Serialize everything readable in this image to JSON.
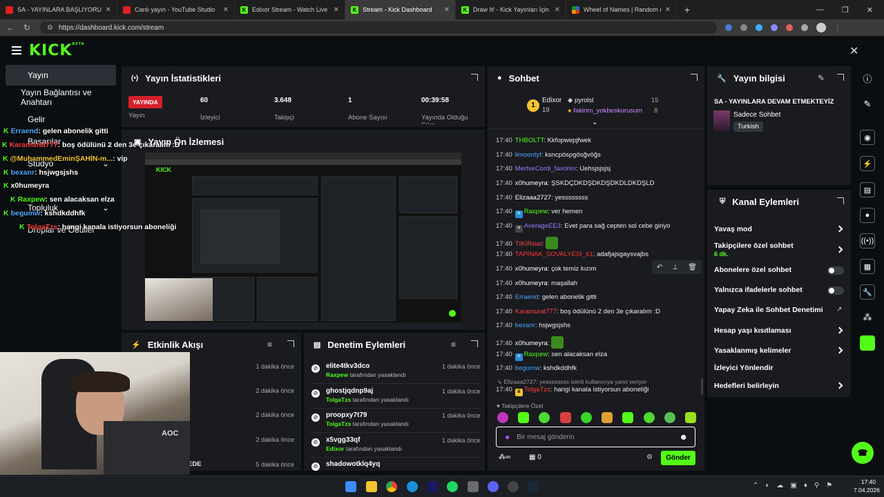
{
  "browser": {
    "tabs": [
      {
        "label": "SA - YAYINLARA BAŞLIYORUM - Yo",
        "icon": "yt"
      },
      {
        "label": "Canlı yayın - YouTube Studio",
        "icon": "yt"
      },
      {
        "label": "Edixor Stream - Watch Live on Kick",
        "icon": "kk"
      },
      {
        "label": "Stream - Kick Dashboard",
        "icon": "kk"
      },
      {
        "label": "Draw It! - Kick Yayınları İçin Çizim",
        "icon": "kk"
      },
      {
        "label": "Wheel of Names | Random name p",
        "icon": "wh"
      }
    ],
    "url": "https://dashboard.kick.com/stream"
  },
  "kick": {
    "logo": "KICK",
    "logo_sup": "BETA"
  },
  "sidebar": {
    "items": [
      "Yayın",
      "Yayın Bağlantısı ve Anahtarı",
      "Gelir",
      "Başarılar",
      "Stüdyo",
      "Topluluk",
      "Droplar ve Ödüller"
    ]
  },
  "stats": {
    "title": "Yayın İstatistikleri",
    "live": "YAYINDA",
    "live_label": "Yayın",
    "viewers": "60",
    "viewers_label": "İzleyici",
    "followers": "3.648",
    "followers_label": "Takipçi",
    "subs": "1",
    "subs_label": "Abone Sayısı",
    "uptime": "00:39:58",
    "uptime_label": "Yayında Olduğu Süre"
  },
  "preview": {
    "title": "Yayın Ön İzlemesi"
  },
  "chat": {
    "title": "Sohbet",
    "leaders": [
      {
        "rank": "1",
        "name": "Edixor",
        "count": "19"
      },
      {
        "name": "pyrolsl",
        "count": "15"
      },
      {
        "name": "fakirim_yokbeskurusum",
        "count": "8"
      }
    ],
    "messages": [
      {
        "t": "17:40",
        "u": "THBOLTT",
        "c": "#53fc18",
        "m": "Kkfopwepjfwek"
      },
      {
        "t": "17:40",
        "u": "limoontyf",
        "c": "#4ea6ff",
        "m": "ksncpöspgösğvöğs"
      },
      {
        "t": "17:40",
        "u": "MertveCordi_favorim",
        "c": "#9b7cff",
        "m": "Uehsjsjsjsj"
      },
      {
        "t": "17:40",
        "u": "x0humeyra",
        "c": "#fff",
        "m": "ŞSKDÇDKDŞDKDŞDKDLDKDŞLD"
      },
      {
        "t": "17:40",
        "u": "Elizaaa2727",
        "c": "#fff",
        "m": "yessssssss"
      },
      {
        "t": "17:40",
        "u": "Raxpew",
        "c": "#53fc18",
        "m": "ver hemen"
      },
      {
        "t": "17:40",
        "u": "AverageEE3",
        "c": "#9b7cff",
        "m": "Evet para sağ cepten sol cebe giriyo"
      },
      {
        "t": "17:40",
        "u": "TIKIRsial",
        "c": "#ff4040",
        "m": ""
      },
      {
        "t": "17:40",
        "u": "TAPINAK_SOVALYESİ_61",
        "c": "#ff3333",
        "m": "adafjajsgaysvajbs"
      },
      {
        "t": "17:40",
        "u": "x0humeyra",
        "c": "#fff",
        "m": "çok temiz kızım"
      },
      {
        "t": "17:40",
        "u": "x0humeyra",
        "c": "#fff",
        "m": "maşallah"
      },
      {
        "t": "17:40",
        "u": "Erraend",
        "c": "#4ea6ff",
        "m": "gelen abonelik gitti"
      },
      {
        "t": "17:40",
        "u": "Karamurat777",
        "c": "#ff4040",
        "m": "boş ödülünü 2 den 3e çıkaralım :D"
      },
      {
        "t": "17:40",
        "u": "bexanr",
        "c": "#4ea6ff",
        "m": "hsjwgsjshs"
      },
      {
        "t": "17:40",
        "u": "x0humeyra",
        "c": "#fff",
        "m": ""
      },
      {
        "t": "17:40",
        "u": "Raxpew",
        "c": "#53fc18",
        "m": "sen alacaksan elza"
      },
      {
        "t": "17:40",
        "u": "begumw",
        "c": "#4ea6ff",
        "m": "kshdkddhfk"
      }
    ],
    "reply_note": "Elizaaa2727: yessssssss isimli kullanıcıya yanıt veriyor",
    "last": {
      "t": "17:40",
      "u": "TolgaTzs",
      "m": "hangi kanala istiyorsun aboneliği"
    },
    "fav_label": "Takipçilere Özel",
    "input_placeholder": "Bir mesaj gönderin",
    "points": "0",
    "send": "Gönder"
  },
  "info": {
    "title": "Yayın bilgisi",
    "stream_title": "SA - YAYINLARA DEVAM ETMEKTEYİZ",
    "category": "Sadece Sohbet",
    "tag": "Turkish"
  },
  "channel": {
    "title": "Kanal Eylemleri",
    "items": [
      {
        "label": "Yavaş mod",
        "kind": "chev"
      },
      {
        "label": "Takipçilere özel sohbet",
        "sub": "6 dk.",
        "kind": "chev"
      },
      {
        "label": "Abonelere özel sohbet",
        "kind": "toggle"
      },
      {
        "label": "Yalnızca ifadelerle sohbet",
        "kind": "toggle"
      },
      {
        "label": "Yapay Zeka ile Sohbet Denetimi",
        "kind": "ext"
      },
      {
        "label": "Hesap yaşı kısıtlaması",
        "kind": "chev"
      },
      {
        "label": "Yasaklanmış kelimeler",
        "kind": "chev"
      },
      {
        "label": "İzleyici Yönlendir",
        "kind": "none"
      },
      {
        "label": "Hedefleri belirleyin",
        "kind": "chev"
      }
    ]
  },
  "activity": {
    "title": "Etkinlik Akışı",
    "items": [
      {
        "name": "",
        "ago": "1 dakika önce"
      },
      {
        "name": "",
        "ago": "2 dakika önce"
      },
      {
        "name": "",
        "ago": "2 dakika önce"
      },
      {
        "name": "",
        "ago": "2 dakika önce"
      },
      {
        "name": "EDE",
        "ago": "5 dakika önce"
      }
    ]
  },
  "moderation": {
    "title": "Denetim Eylemleri",
    "suffix": "tarafından yasaklandı",
    "items": [
      {
        "name": "elite4tkv3dco",
        "by": "Raxpew",
        "c": "#53fc18",
        "ago": "1 dakika önce"
      },
      {
        "name": "ghostjqdnp9aj",
        "by": "TolgaTzs",
        "c": "#53fc18",
        "ago": "1 dakika önce"
      },
      {
        "name": "proopxy7t79",
        "by": "TolgaTzs",
        "c": "#53fc18",
        "ago": "1 dakika önce"
      },
      {
        "name": "x5vgg33qf",
        "by": "Edixor",
        "c": "#53fc18",
        "ago": "1 dakika önce"
      },
      {
        "name": "shadowotklq4yq",
        "by": "",
        "c": "#53fc18",
        "ago": ""
      }
    ]
  },
  "overlay": [
    {
      "u": "Erraend",
      "c": "#4ea6ff",
      "m": ": gelen abonelik gitti"
    },
    {
      "u": "Karamurat777",
      "c": "#ff3b3b",
      "m": ": boş ödülünü 2 den 3e çıkaralım :D"
    },
    {
      "u": "@MuhammedEminŞAHİN-m...",
      "c": "#f4c430",
      "m": ": vip"
    },
    {
      "u": "bexanr",
      "c": "#4ea6ff",
      "m": ": hsjwgsjshs"
    },
    {
      "u": "x0humeyra",
      "c": "#fff",
      "m": ""
    },
    {
      "u": "Raxpew",
      "c": "#53fc18",
      "m": ": sen alacaksan elza"
    },
    {
      "u": "begumw",
      "c": "#4ea6ff",
      "m": ": kshdkddhfk"
    },
    {
      "u": "TolgaTzs",
      "c": "#ff3b3b",
      "m": ": hangi kanala istiyorsun aboneliği"
    }
  ],
  "clock": {
    "time": "17:40",
    "date": "7.04.2026"
  },
  "colors": {
    "kick_green": "#53fc18",
    "panel": "#191b1f",
    "bg": "#0b0e11",
    "live_red": "#d4202c"
  }
}
